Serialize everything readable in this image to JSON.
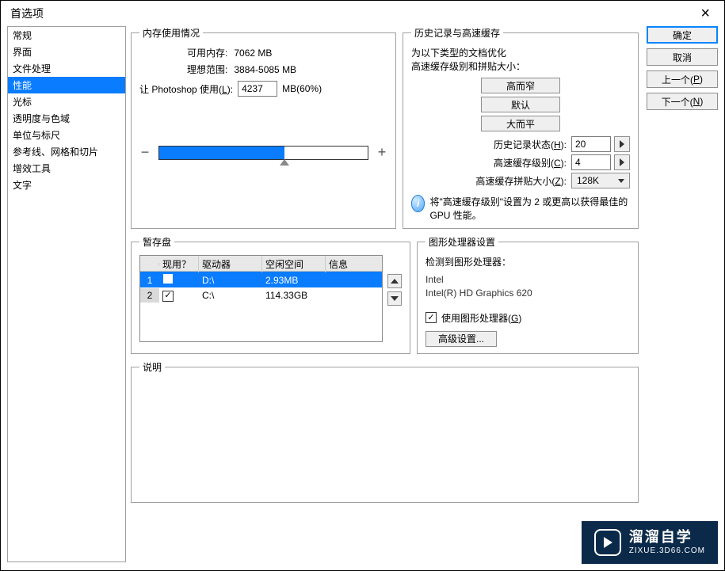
{
  "window": {
    "title": "首选项"
  },
  "sidebar": {
    "items": [
      {
        "label": "常规"
      },
      {
        "label": "界面"
      },
      {
        "label": "文件处理"
      },
      {
        "label": "性能",
        "selected": true
      },
      {
        "label": "光标"
      },
      {
        "label": "透明度与色域"
      },
      {
        "label": "单位与标尺"
      },
      {
        "label": "参考线、网格和切片"
      },
      {
        "label": "增效工具"
      },
      {
        "label": "文字"
      }
    ]
  },
  "buttons": {
    "ok": "确定",
    "cancel": "取消",
    "prev_pre": "上一个(",
    "prev_u": "P",
    "prev_post": ")",
    "next_pre": "下一个(",
    "next_u": "N",
    "next_post": ")"
  },
  "memory": {
    "legend": "内存使用情况",
    "available_label": "可用内存:",
    "available_value": "7062 MB",
    "ideal_label": "理想范围:",
    "ideal_value": "3884-5085 MB",
    "let_label_pre": "让 Photoshop 使用(",
    "let_label_u": "L",
    "let_label_post": "):",
    "let_value": "4237",
    "let_unit": "MB(60%)"
  },
  "history": {
    "legend": "历史记录与高速缓存",
    "opt_line1": "为以下类型的文档优化",
    "opt_line2": "高速缓存级别和拼贴大小：",
    "btn_tall": "高而窄",
    "btn_default": "默认",
    "btn_wide": "大而平",
    "history_label_pre": "历史记录状态(",
    "history_label_u": "H",
    "history_label_post": "):",
    "history_value": "20",
    "cache_label_pre": "高速缓存级别(",
    "cache_label_u": "C",
    "cache_label_post": "):",
    "cache_value": "4",
    "tile_label_pre": "高速缓存拼贴大小(",
    "tile_label_u": "Z",
    "tile_label_post": "):",
    "tile_value": "128K",
    "info_text": "将\"高速缓存级别\"设置为 2 或更高以获得最佳的 GPU 性能。"
  },
  "scratch": {
    "legend": "暂存盘",
    "col_active": "现用？",
    "col_drive": "驱动器",
    "col_free": "空闲空间",
    "col_info": "信息",
    "rows": [
      {
        "idx": "1",
        "active": false,
        "drive": "D:\\",
        "free": "2.93MB",
        "info": ""
      },
      {
        "idx": "2",
        "active": true,
        "drive": "C:\\",
        "free": "114.33GB",
        "info": ""
      }
    ]
  },
  "gpu": {
    "legend": "图形处理器设置",
    "detected_label": "检测到图形处理器：",
    "vendor": "Intel",
    "name": "Intel(R) HD Graphics 620",
    "use_gpu_pre": "使用图形处理器(",
    "use_gpu_u": "G",
    "use_gpu_post": ")",
    "advanced_btn": "高级设置..."
  },
  "desc": {
    "legend": "说明"
  },
  "watermark": {
    "big": "溜溜自学",
    "small": "ZIXUE.3D66.COM"
  }
}
